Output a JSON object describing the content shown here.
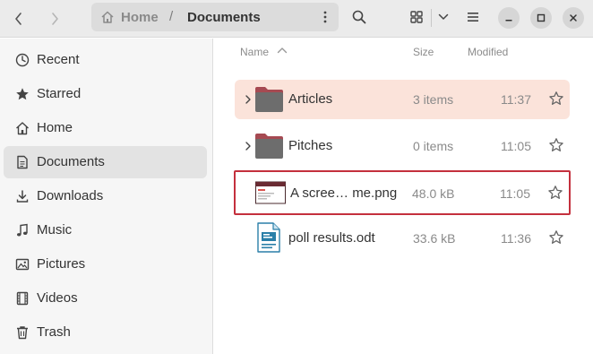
{
  "header": {
    "path": {
      "home_label": "Home",
      "separator": "/",
      "current_label": "Documents"
    },
    "icons": {
      "back": "chevron-left-icon",
      "forward": "chevron-right-icon",
      "home": "home-icon",
      "path_menu": "vertical-ellipsis-icon",
      "search": "search-icon",
      "view": "grid-view-icon",
      "view_dropdown": "chevron-down-icon",
      "main_menu": "hamburger-icon",
      "minimize": "minimize-icon",
      "maximize": "maximize-icon",
      "close": "close-icon"
    }
  },
  "sidebar": {
    "items": [
      {
        "label": "Recent",
        "icon": "clock-icon",
        "active": false
      },
      {
        "label": "Starred",
        "icon": "star-icon",
        "active": false
      },
      {
        "label": "Home",
        "icon": "home-icon",
        "active": false
      },
      {
        "label": "Documents",
        "icon": "document-icon",
        "active": true
      },
      {
        "label": "Downloads",
        "icon": "download-icon",
        "active": false
      },
      {
        "label": "Music",
        "icon": "music-note-icon",
        "active": false
      },
      {
        "label": "Pictures",
        "icon": "picture-icon",
        "active": false
      },
      {
        "label": "Videos",
        "icon": "film-icon",
        "active": false
      },
      {
        "label": "Trash",
        "icon": "trash-icon",
        "active": false
      }
    ]
  },
  "main": {
    "columns": {
      "name": "Name",
      "size": "Size",
      "modified": "Modified",
      "sort": "ascending"
    },
    "rows": [
      {
        "name": "Articles",
        "size": "3 items",
        "modified": "11:37",
        "type": "folder",
        "selected": true
      },
      {
        "name": "Pitches",
        "size": "0 items",
        "modified": "11:05",
        "type": "folder",
        "selected": false
      },
      {
        "name": "A scree… me.png",
        "size": "48.0 kB",
        "modified": "11:05",
        "type": "image",
        "selected": false,
        "focused": true
      },
      {
        "name": "poll results.odt",
        "size": "33.6 kB",
        "modified": "11:36",
        "type": "document",
        "selected": false
      }
    ]
  },
  "colors": {
    "selection": "#fbe3da",
    "focus_outline": "#c4303d",
    "folder": "#6d6d6d",
    "folder_tab": "#a64a52",
    "sidebar_active": "#e3e3e3"
  }
}
